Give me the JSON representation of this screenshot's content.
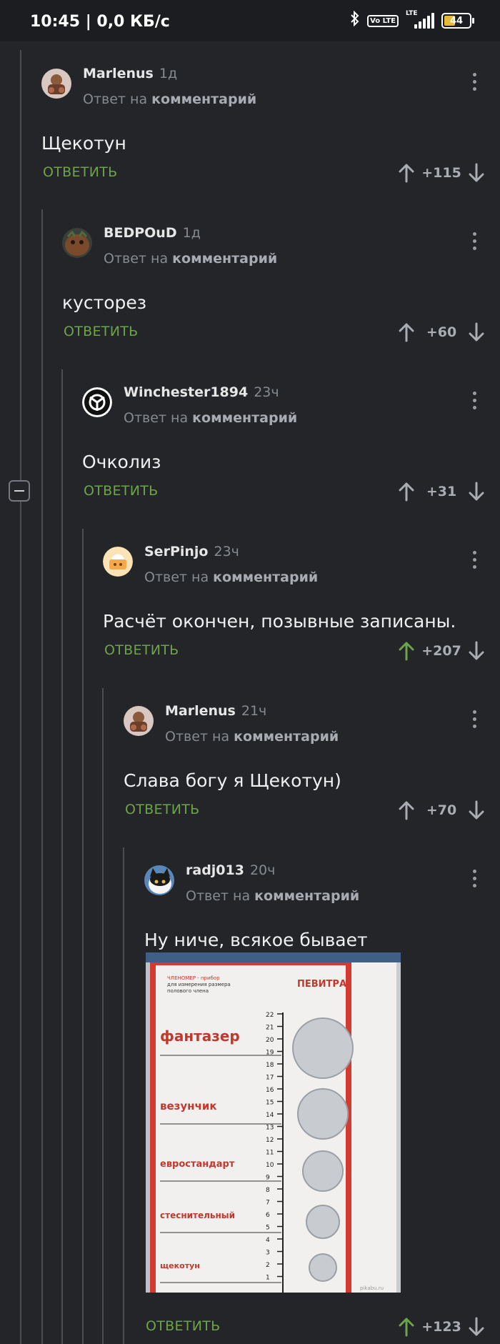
{
  "status_bar": {
    "time": "10:45 | 0,0 КБ/с",
    "volte": "Vo LTE",
    "network": "LTE",
    "battery": "44"
  },
  "comments": [
    {
      "username": "Marlenus",
      "time": "1д",
      "reply_prefix": "Ответ на",
      "reply_target": "комментарий",
      "text": "Щекотун",
      "reply_label": "ОТВЕТИТЬ",
      "score": "+115",
      "upvoted": false
    },
    {
      "username": "BEDPOuD",
      "time": "1д",
      "reply_prefix": "Ответ на",
      "reply_target": "комментарий",
      "text": "кусторез",
      "reply_label": "ОТВЕТИТЬ",
      "score": "+60",
      "upvoted": false
    },
    {
      "username": "Winchester1894",
      "time": "23ч",
      "reply_prefix": "Ответ на",
      "reply_target": "комментарий",
      "text": "Очколиз",
      "reply_label": "ОТВЕТИТЬ",
      "score": "+31",
      "upvoted": false
    },
    {
      "username": "SerPinjo",
      "time": "23ч",
      "reply_prefix": "Ответ на",
      "reply_target": "комментарий",
      "text": "Расчёт окончен, позывные записаны.",
      "reply_label": "ОТВЕТИТЬ",
      "score": "+207",
      "upvoted": true
    },
    {
      "username": "Marlenus",
      "time": "21ч",
      "reply_prefix": "Ответ на",
      "reply_target": "комментарий",
      "text": "Слава богу я Щекотун)",
      "reply_label": "ОТВЕТИТЬ",
      "score": "+70",
      "upvoted": false
    },
    {
      "username": "radj013",
      "time": "20ч",
      "reply_prefix": "Ответ на",
      "reply_target": "комментарий",
      "text": "Ну ниче, всякое бывает",
      "reply_label": "ОТВЕТИТЬ",
      "score": "+123",
      "upvoted": true
    }
  ],
  "attached_image": {
    "header": "ЧЛЕНОМЕР - прибор для измерения размера полового члена",
    "brand": "ПЕВИТРА",
    "categories": [
      "фантазер",
      "везунчик",
      "евростандарт",
      "стеснительный",
      "щекотун"
    ],
    "scale": [
      "22",
      "21",
      "20",
      "19",
      "18",
      "17",
      "16",
      "15",
      "14",
      "13",
      "12",
      "11",
      "10",
      "9",
      "8",
      "7",
      "6",
      "5",
      "4",
      "3",
      "2",
      "1"
    ],
    "watermark": "pikabu.ru"
  },
  "colors": {
    "background": "#232529",
    "accent_green": "#6ca44a",
    "muted_text": "#868a91",
    "thread_line": "#4a4d52"
  },
  "icons": [
    "bluetooth-icon",
    "volte-icon",
    "signal-icon",
    "battery-icon",
    "kebab-menu-icon",
    "upvote-arrow-icon",
    "downvote-arrow-icon",
    "collapse-thread-icon"
  ]
}
